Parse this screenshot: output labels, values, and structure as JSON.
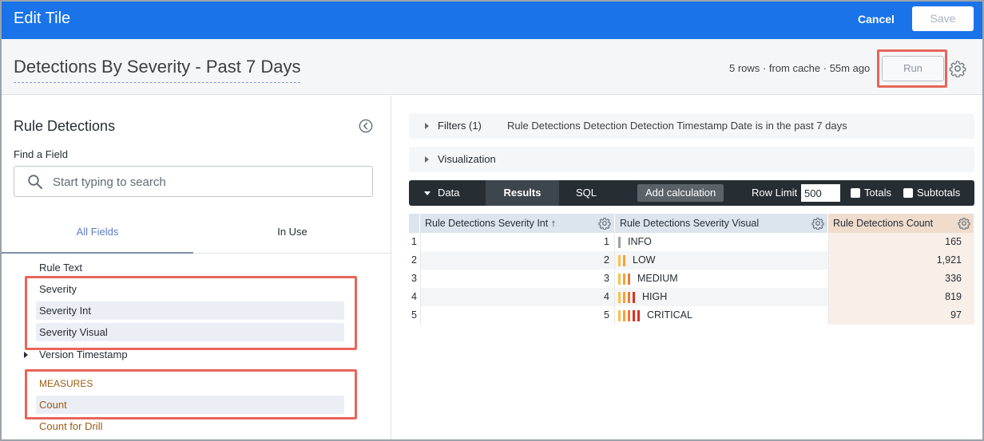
{
  "header": {
    "title": "Edit Tile",
    "cancel_label": "Cancel",
    "save_label": "Save",
    "accent_color": "#1a73e8"
  },
  "look": {
    "title": "Detections By Severity - Past 7 Days",
    "status": "5 rows · from cache · 55m ago",
    "run_label": "Run",
    "settings_icon": "gear-icon"
  },
  "field_picker": {
    "explore_name": "Rule Detections",
    "collapse_icon": "chevron-left-circle-icon",
    "find_label": "Find a Field",
    "search_placeholder": "Start typing to search",
    "tabs": [
      {
        "label": "All Fields",
        "active": true
      },
      {
        "label": "In Use",
        "active": false
      }
    ],
    "dimensions": [
      {
        "label": "Rule Text",
        "selected": false
      },
      {
        "label": "Severity",
        "selected": false
      },
      {
        "label": "Severity Int",
        "selected": true
      },
      {
        "label": "Severity Visual",
        "selected": true
      },
      {
        "label": "Version Timestamp",
        "selected": false,
        "group": true
      }
    ],
    "measures_heading": "MEASURES",
    "measures": [
      {
        "label": "Count",
        "selected": true
      },
      {
        "label": "Count for Drill",
        "selected": false
      }
    ]
  },
  "panels": {
    "filters_label": "Filters (1)",
    "filters_desc": "Rule Detections Detection Detection Timestamp Date is in the past 7 days",
    "visualization_label": "Visualization"
  },
  "databar": {
    "data_label": "Data",
    "results_label": "Results",
    "sql_label": "SQL",
    "add_calc_label": "Add calculation",
    "row_limit_label": "Row Limit",
    "row_limit_value": "500",
    "totals_label": "Totals",
    "subtotals_label": "Subtotals"
  },
  "results_table": {
    "columns": [
      {
        "label": "Rule Detections Severity Int ↑",
        "kind": "dimension"
      },
      {
        "label": "Rule Detections Severity Visual",
        "kind": "dimension"
      },
      {
        "label": "Rule Detections Count",
        "kind": "measure"
      }
    ],
    "rows": [
      {
        "num": "1",
        "int": "1",
        "visual": "INFO",
        "count": "165",
        "bars": 1
      },
      {
        "num": "2",
        "int": "2",
        "visual": "LOW",
        "count": "1,921",
        "bars": 2
      },
      {
        "num": "3",
        "int": "3",
        "visual": "MEDIUM",
        "count": "336",
        "bars": 3
      },
      {
        "num": "4",
        "int": "4",
        "visual": "HIGH",
        "count": "819",
        "bars": 4
      },
      {
        "num": "5",
        "int": "5",
        "visual": "CRITICAL",
        "count": "97",
        "bars": 5
      }
    ],
    "colors": {
      "dimension_header": "#dce4ee",
      "measure_header": "#efdccd",
      "measure_cell": "#f8efe9",
      "bar_info": "#9aa0a6",
      "bar_low": "#f6c343",
      "bar_medium": "#f2a33a",
      "bar_high": "#ec7b3b",
      "bar_critical": "#d93025",
      "highlight": "#e8655a"
    }
  }
}
